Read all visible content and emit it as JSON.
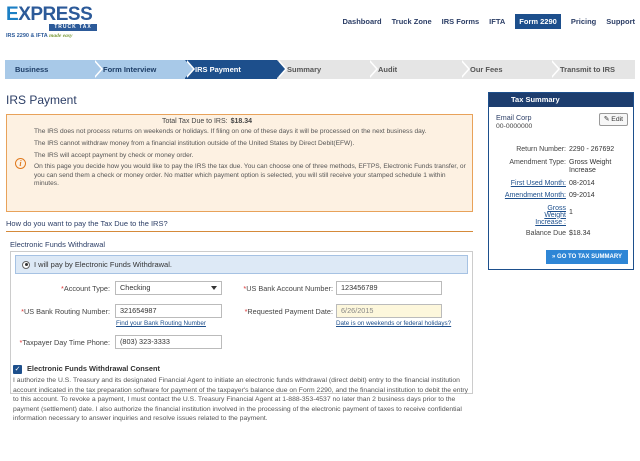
{
  "brand": {
    "name_part1": "E",
    "name_part2": "XPRESS",
    "bar_text": "TRUCK TAX",
    "tagline_bold": "IRS 2290 & IFTA",
    "tagline_italic": "made easy"
  },
  "nav": {
    "items": [
      "Dashboard",
      "Truck Zone",
      "IRS Forms",
      "IFTA",
      "Form 2290",
      "Pricing",
      "Support"
    ],
    "active": "Form 2290"
  },
  "steps": [
    "Business",
    "Form Interview",
    "IRS Payment",
    "Summary",
    "Audit",
    "Our Fees",
    "Transmit to IRS"
  ],
  "page_title": "IRS Payment",
  "notice": {
    "total_label": "Total Tax Due to IRS:",
    "total_value": "$18.34",
    "lines": [
      "The IRS does not process returns on weekends or holidays. If filing on one of these days it will be processed on the next business day.",
      "The IRS cannot withdraw money from a financial institution outside of the United States by Direct Debit(EFW).",
      "The IRS will accept payment by check or money order.",
      "On this page you decide how you would like to pay the IRS the tax due. You can choose one of three methods, EFTPS, Electronic Funds transfer, or you can send them a check or money order. No matter which payment option is selected, you will still receive your stamped schedule 1 within minutes."
    ]
  },
  "question": "How do you want to pay the Tax Due to the IRS?",
  "efw": {
    "title": "Electronic Funds Withdrawal",
    "radio_label": "I will pay by Electronic Funds Withdrawal.",
    "account_type_label": "Account Type:",
    "account_type_value": "Checking",
    "bank_account_label": "US Bank Account Number:",
    "bank_account_value": "123456789",
    "routing_label": "US Bank Routing Number:",
    "routing_value": "321654987",
    "routing_hint": "Find your Bank Routing Number",
    "payment_date_label": "Requested Payment Date:",
    "payment_date_value": "6/26/2015",
    "payment_date_hint": "Date is on weekends or federal holidays?",
    "phone_label": "Taxpayer Day Time Phone:",
    "phone_value": "(803) 323-3333",
    "consent_title": "Electronic Funds Withdrawal Consent",
    "consent_text": "I authorize the U.S. Treasury and its designated Financial Agent to initiate an electronic funds withdrawal (direct debit) entry to the financial institution account indicated in the tax preparation software for payment of the taxpayer's balance due on Form 2290, and the financial institution to debit the entry to this account. To revoke a payment, I must contact the U.S. Treasury Financial Agent at 1-888-353-4537 no later than 2 business days prior to the payment (settlement) date. I also authorize the financial institution involved in the processing of the electronic payment of taxes to receive confidential information necessary to answer inquiries and resolve issues related to the payment."
  },
  "tax_summary": {
    "title": "Tax Summary",
    "business_name": "Email Corp",
    "ein": "00-0000000",
    "edit_label": "Edit",
    "return_number_label": "Return Number:",
    "return_number_value": "2290 - 267692",
    "amendment_type_label": "Amendment Type:",
    "amendment_type_value": "Gross Weight Increase",
    "first_used_label": "First Used Month:",
    "first_used_value": "08-2014",
    "amendment_month_label": "Amendment Month:",
    "amendment_month_value": "09-2014",
    "gross_weight_label": "Gross Weight Increase :",
    "gross_weight_value": "1",
    "balance_due_label": "Balance Due",
    "balance_due_value": "$18.34",
    "button_label": "» GO TO TAX SUMMARY"
  },
  "colors": {
    "brand_blue": "#1d4f8c",
    "notice_bg": "#fdf1e2",
    "notice_border": "#e8a25a",
    "accent_button": "#2e86d6"
  }
}
